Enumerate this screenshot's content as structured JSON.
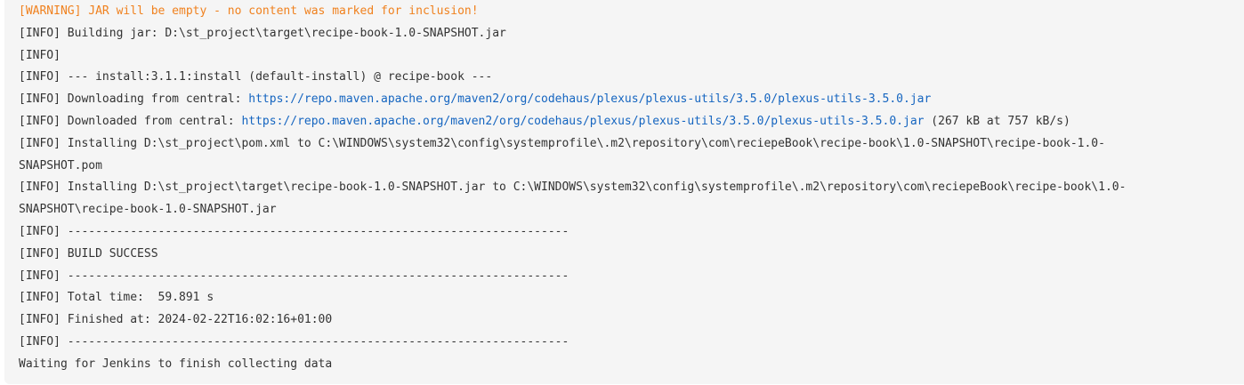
{
  "colors": {
    "console_bg": "#f5f5f5",
    "text": "#333333",
    "warning": "#f0811e",
    "link": "#1565c0"
  },
  "console": {
    "lines": [
      {
        "kind": "warning",
        "text": "[WARNING] JAR will be empty - no content was marked for inclusion!"
      },
      {
        "kind": "info",
        "text": "[INFO] Building jar: D:\\st_project\\target\\recipe-book-1.0-SNAPSHOT.jar"
      },
      {
        "kind": "info",
        "text": "[INFO]"
      },
      {
        "kind": "info",
        "text": "[INFO] --- install:3.1.1:install (default-install) @ recipe-book ---"
      },
      {
        "kind": "link",
        "prefix": "[INFO] Downloading from central: ",
        "url": "https://repo.maven.apache.org/maven2/org/codehaus/plexus/plexus-utils/3.5.0/plexus-utils-3.5.0.jar",
        "suffix": ""
      },
      {
        "kind": "link",
        "prefix": "[INFO] Downloaded from central: ",
        "url": "https://repo.maven.apache.org/maven2/org/codehaus/plexus/plexus-utils/3.5.0/plexus-utils-3.5.0.jar",
        "suffix": " (267 kB at 757 kB/s)"
      },
      {
        "kind": "info",
        "text": "[INFO] Installing D:\\st_project\\pom.xml to C:\\WINDOWS\\system32\\config\\systemprofile\\.m2\\repository\\com\\reciepeBook\\recipe-book\\1.0-SNAPSHOT\\recipe-book-1.0-"
      },
      {
        "kind": "info",
        "text": "SNAPSHOT.pom"
      },
      {
        "kind": "info",
        "text": "[INFO] Installing D:\\st_project\\target\\recipe-book-1.0-SNAPSHOT.jar to C:\\WINDOWS\\system32\\config\\systemprofile\\.m2\\repository\\com\\reciepeBook\\recipe-book\\1.0-"
      },
      {
        "kind": "info",
        "text": "SNAPSHOT\\recipe-book-1.0-SNAPSHOT.jar"
      },
      {
        "kind": "info",
        "text": "[INFO] ------------------------------------------------------------------------"
      },
      {
        "kind": "info",
        "text": "[INFO] BUILD SUCCESS"
      },
      {
        "kind": "info",
        "text": "[INFO] ------------------------------------------------------------------------"
      },
      {
        "kind": "info",
        "text": "[INFO] Total time:  59.891 s"
      },
      {
        "kind": "info",
        "text": "[INFO] Finished at: 2024-02-22T16:02:16+01:00"
      },
      {
        "kind": "info",
        "text": "[INFO] ------------------------------------------------------------------------"
      },
      {
        "kind": "info",
        "text": "Waiting for Jenkins to finish collecting data"
      }
    ]
  }
}
